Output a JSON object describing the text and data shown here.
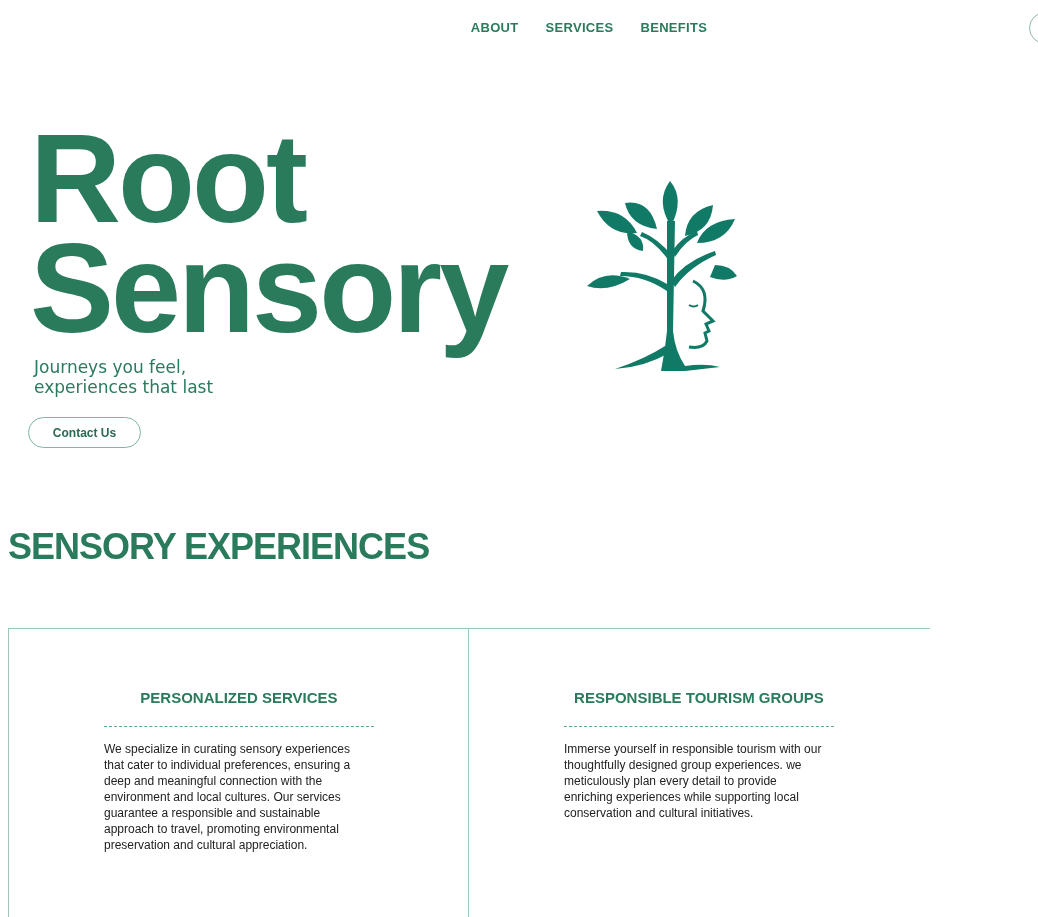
{
  "nav": {
    "links": [
      "ABOUT",
      "SERVICES",
      "BENEFITS"
    ]
  },
  "hero": {
    "title_lines": [
      "Root",
      "Sensory"
    ],
    "tagline_lines": [
      "Journeys you feel,",
      "experiences that last"
    ],
    "button": "Contact Us"
  },
  "section": {
    "heading": "SENSORY EXPERIENCES",
    "cards": [
      {
        "title": "PERSONALIZED SERVICES",
        "text": "We specialize in curating sensory experiences that cater to individual preferences, ensuring a deep and meaningful connection with the environment and local cultures. Our services guarantee a responsible and sustainable approach to travel, promoting environmental preservation and cultural appreciation."
      },
      {
        "title": "RESPONSIBLE TOURISM GROUPS",
        "text": "Immerse yourself in responsible tourism with our thoughtfully designed group experiences. we meticulously plan every detail to provide enriching experiences while supporting local conservation and cultural initiatives."
      }
    ]
  }
}
